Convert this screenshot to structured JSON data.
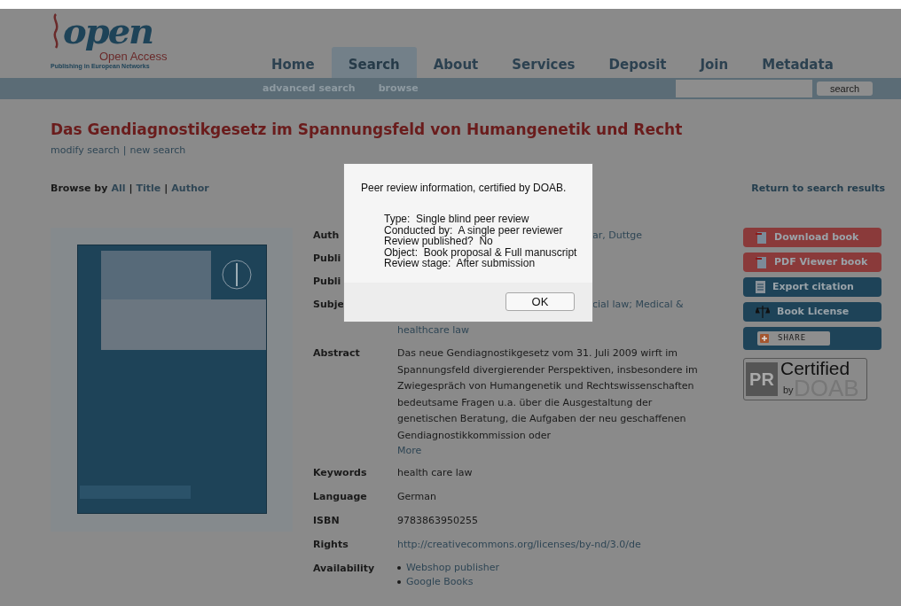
{
  "logo": {
    "word": "open",
    "subtitle": "Open Access",
    "tagline": "Publishing in European Networks"
  },
  "nav": [
    {
      "label": "Home",
      "selected": false
    },
    {
      "label": "Search",
      "selected": true
    },
    {
      "label": "About",
      "selected": false
    },
    {
      "label": "Services",
      "selected": false
    },
    {
      "label": "Deposit",
      "selected": false
    },
    {
      "label": "Join",
      "selected": false
    },
    {
      "label": "Metadata",
      "selected": false
    }
  ],
  "subnav": [
    "advanced search",
    "browse"
  ],
  "search": {
    "button": "search"
  },
  "title": "Das Gendiagnostikgesetz im Spannungsfeld von Humangenetik und Recht",
  "search_links": {
    "items": [
      "modify search",
      "new search"
    ],
    "separator": "|"
  },
  "browse_by": {
    "label": "Browse by",
    "items": [
      "All",
      "Title",
      "Author"
    ],
    "separator": "|"
  },
  "return_link": "Return to search results",
  "details": [
    {
      "label": "Auth",
      "kind": "partial",
      "values": [
        "ar, Duttge"
      ]
    },
    {
      "label": "Publi",
      "kind": "partial"
    },
    {
      "label": "Publi",
      "kind": "partial"
    },
    {
      "label": "Subje",
      "kind": "partial",
      "values": [
        "cial law; Medical &",
        "healthcare law"
      ]
    },
    {
      "label": "Abstract",
      "kind": "abstract",
      "values": [
        "Das neue Gendiagnostikgesetz vom 31. Juli 2009 wirft im Spannungsfeld divergierender Perspektiven, insbesondere im Zwiegespräch von Humangenetik und Rechtswissenschaften bedeutsame Fragen u.a. über die Ausgestaltung der genetischen Beratung, die Aufgaben der neu geschaffenen Gendiagnostikkommission oder"
      ],
      "more": "More"
    },
    {
      "label": "Keywords",
      "kind": "text",
      "values": [
        "health care law"
      ]
    },
    {
      "label": "Language",
      "kind": "text",
      "values": [
        "German"
      ]
    },
    {
      "label": "ISBN",
      "kind": "text",
      "values": [
        "9783863950255"
      ]
    },
    {
      "label": "Rights",
      "kind": "link",
      "values": [
        "http://creativecommons.org/licenses/by-nd/3.0/de"
      ]
    },
    {
      "label": "Availability",
      "kind": "bullets",
      "values": [
        "Webshop publisher",
        "Google Books"
      ]
    }
  ],
  "actions": [
    {
      "label": "Download book",
      "kind": "download"
    },
    {
      "label": "PDF Viewer book",
      "kind": "pdf"
    },
    {
      "label": "Export citation",
      "kind": "export"
    },
    {
      "label": "Book License",
      "kind": "license"
    },
    {
      "label": "SHARE",
      "kind": "share"
    }
  ],
  "badge": {
    "pr": "PR",
    "certified": "Certified",
    "by": "by",
    "doab": "DOAB"
  },
  "dialog": {
    "heading": "Peer review information, certified by DOAB.",
    "lines": [
      "Type:  Single blind peer review",
      "Conducted by:  A single peer reviewer",
      "Review published?  No",
      "Object:  Book proposal & Full manuscript",
      "Review stage:  After submission"
    ],
    "button": "OK"
  }
}
